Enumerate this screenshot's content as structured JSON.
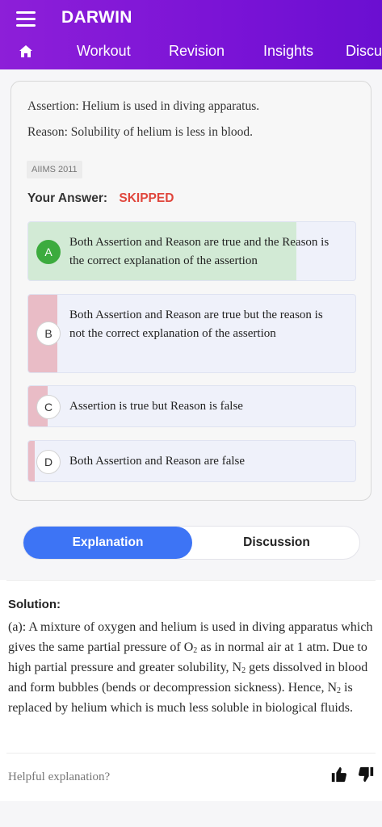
{
  "app": {
    "title": "DARWIN"
  },
  "nav": {
    "items": [
      "Workout",
      "Revision",
      "Insights",
      "Discu"
    ]
  },
  "question": {
    "assertion": "Assertion: Helium is used in diving apparatus.",
    "reason": "Reason: Solubility of helium is less in blood.",
    "tag": "AIIMS 2011",
    "your_answer_label": "Your Answer:",
    "your_answer_value": "SKIPPED",
    "options": [
      {
        "letter": "A",
        "text": "Both Assertion and Reason are true and the Reason is the correct explanation of the assertion",
        "correct": true
      },
      {
        "letter": "B",
        "text": "Both Assertion and Reason are true but the reason is not the correct explanation of the assertion",
        "correct": false
      },
      {
        "letter": "C",
        "text": "Assertion is true but Reason is false",
        "correct": false
      },
      {
        "letter": "D",
        "text": "Both Assertion and Reason are false",
        "correct": false
      }
    ]
  },
  "tabs": {
    "explanation": "Explanation",
    "discussion": "Discussion"
  },
  "solution": {
    "title": "Solution:",
    "line1": "(a): A mixture of oxygen and helium is used in diving apparatus which gives the same partial pressure of O",
    "sub1": "2",
    "line2": " as in normal air at 1 atm. Due to high partial pressure and greater solubility, N",
    "sub2": "2",
    "line3": " gets dissolved in blood and form bubbles (bends or decompression sickness). Hence, N",
    "sub3": "2",
    "line4": " is replaced by helium which is much less soluble in biological fluids.",
    "helpful_label": "Helpful explanation?"
  },
  "colors": {
    "header": "#7a13d6",
    "correct_fill": "#d2ead5",
    "wrong_fill": "#e9bcc6",
    "tab_active": "#3d74f5",
    "skipped": "#e0463c"
  }
}
